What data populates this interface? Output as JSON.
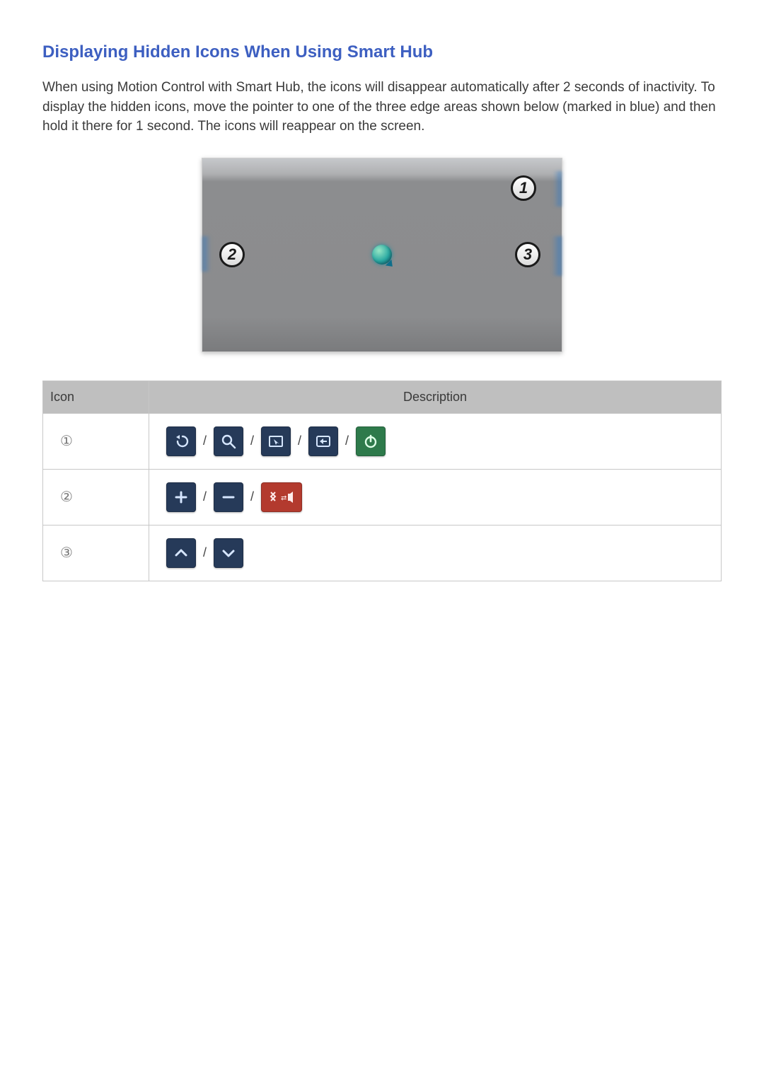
{
  "title": "Displaying Hidden Icons When Using Smart Hub",
  "paragraph": "When using Motion Control with Smart Hub, the icons will disappear automatically after 2 seconds of inactivity. To display the hidden icons, move the pointer to one of the three edge areas shown below (marked in blue) and then hold it there for 1 second. The icons will reappear on the screen.",
  "callouts": {
    "one": "1",
    "two": "2",
    "three": "3"
  },
  "table": {
    "headers": {
      "icon": "Icon",
      "desc": "Description"
    },
    "rows": {
      "r1_label": "①",
      "r2_label": "②",
      "r3_label": "③"
    },
    "separator": "/"
  },
  "icons": {
    "row1": [
      "back-icon",
      "search-icon",
      "pointer-box-icon",
      "return-icon",
      "power-icon"
    ],
    "row2": [
      "plus-icon",
      "minus-icon",
      "mute-speaker-icon"
    ],
    "row3": [
      "chevron-up-icon",
      "chevron-down-icon"
    ]
  }
}
